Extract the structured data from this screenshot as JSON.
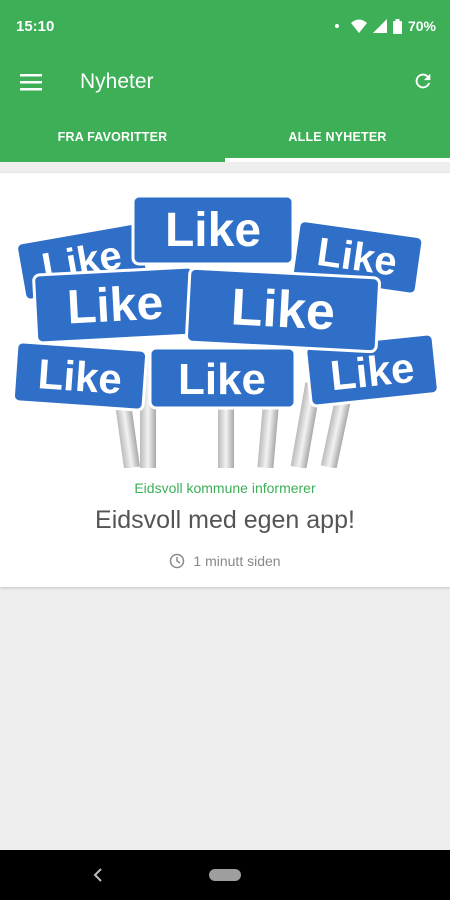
{
  "status_bar": {
    "time": "15:10",
    "battery": "70%",
    "icons": [
      "notification-dot-icon",
      "wifi-icon",
      "signal-icon",
      "battery-icon"
    ]
  },
  "app_bar": {
    "title": "Nyheter",
    "menu_icon": "hamburger-menu-icon",
    "refresh_icon": "refresh-icon",
    "color": "#3daf57"
  },
  "tabs": [
    {
      "label": "FRA FAVORITTER",
      "active": false
    },
    {
      "label": "ALLE NYHETER",
      "active": true
    }
  ],
  "news": [
    {
      "source": "Eidsvoll kommune informerer",
      "title": "Eidsvoll med egen app!",
      "time": "1 minutt siden",
      "image_sign_text": "Like"
    }
  ],
  "nav_bar": {
    "back_icon": "back-chevron-icon",
    "home_icon": "home-pill-icon"
  }
}
